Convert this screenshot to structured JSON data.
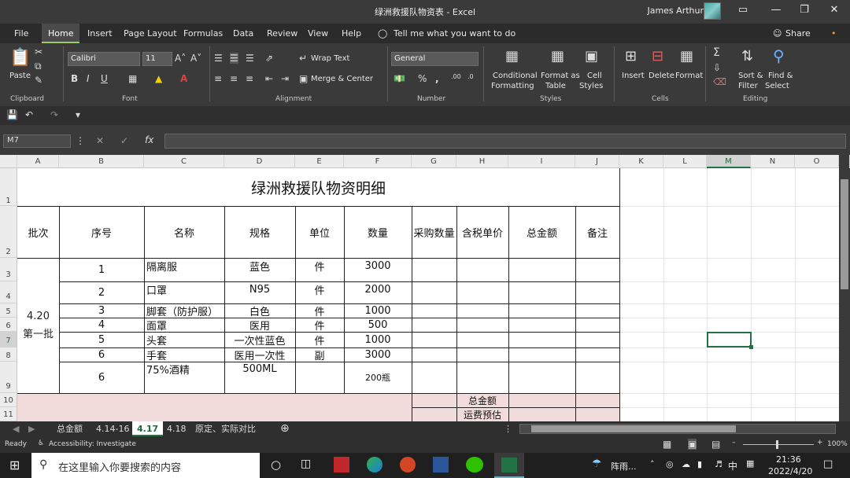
{
  "window": {
    "title": "绿洲救援队物资表  -  Excel",
    "user": "James Arthur",
    "controls": [
      "▭",
      "—",
      "❐",
      "✕"
    ]
  },
  "menu": {
    "items": [
      "File",
      "Home",
      "Insert",
      "Page Layout",
      "Formulas",
      "Data",
      "Review",
      "View",
      "Help"
    ],
    "tell_me": "Tell me what you want to do",
    "share": "Share"
  },
  "ribbon": {
    "clipboard": {
      "label": "Clipboard",
      "paste": "Paste"
    },
    "font": {
      "label": "Font",
      "name": "Calibri",
      "size": "11",
      "bold": "B",
      "italic": "I",
      "underline": "U"
    },
    "alignment": {
      "label": "Alignment",
      "wrap": "Wrap Text",
      "merge": "Merge & Center"
    },
    "number": {
      "label": "Number",
      "format": "General"
    },
    "styles": {
      "label": "Styles",
      "conditional": [
        "Conditional",
        "Formatting"
      ],
      "format_table": [
        "Format as",
        "Table"
      ],
      "cell_styles": [
        "Cell",
        "Styles"
      ]
    },
    "cells": {
      "label": "Cells",
      "insert": "Insert",
      "delete": "Delete",
      "format": "Format"
    },
    "editing": {
      "label": "Editing",
      "sort": [
        "Sort &",
        "Filter"
      ],
      "find": [
        "Find &",
        "Select"
      ]
    }
  },
  "formula_bar": {
    "name_box": "M7",
    "fx": "fx",
    "value": ""
  },
  "columns": [
    "A",
    "B",
    "C",
    "D",
    "E",
    "F",
    "G",
    "H",
    "I",
    "J",
    "K",
    "L",
    "M",
    "N",
    "O"
  ],
  "rows": [
    "1",
    "2",
    "3",
    "4",
    "5",
    "6",
    "7",
    "8",
    "9",
    "10",
    "11"
  ],
  "sheet": {
    "title": "绿洲救援队物资明细",
    "headers": [
      "批次",
      "序号",
      "名称",
      "规格",
      "单位",
      "数量",
      "采购数量",
      "含税单价",
      "总金额",
      "备注"
    ],
    "batch": [
      "4.20",
      "第一批"
    ],
    "items": [
      {
        "seq": "1",
        "name": "隔离服",
        "spec": "蓝色",
        "unit": "件",
        "qty": "3000"
      },
      {
        "seq": "2",
        "name": "口罩",
        "spec": "N95",
        "unit": "件",
        "qty": "2000"
      },
      {
        "seq": "3",
        "name": "脚套（防护服）",
        "spec": "白色",
        "unit": "件",
        "qty": "1000"
      },
      {
        "seq": "4",
        "name": "面罩",
        "spec": "医用",
        "unit": "件",
        "qty": "500"
      },
      {
        "seq": "5",
        "name": "头套",
        "spec": "一次性蓝色",
        "unit": "件",
        "qty": "1000"
      },
      {
        "seq": "6",
        "name": "手套",
        "spec": "医用一次性",
        "unit": "副",
        "qty": "3000"
      },
      {
        "seq": "6",
        "name": "75%酒精",
        "spec": "500ML",
        "unit": "",
        "qty": "200瓶"
      }
    ],
    "totals": [
      "总金额",
      "运费预估"
    ]
  },
  "tabs": [
    "总金额",
    "4.14-16",
    "4.17",
    "4.18",
    "原定、实际对比"
  ],
  "active_tab": "4.17",
  "status": {
    "ready": "Ready",
    "accessibility": "Accessibility: Investigate",
    "zoom": "100%"
  },
  "taskbar": {
    "search": "在这里输入你要搜索的内容",
    "weather": "阵雨...",
    "lang": "中",
    "time": "21:36",
    "date": "2022/4/20"
  },
  "colors": {
    "accent": "#217346",
    "pink_fill": "#f2dcdb",
    "chrome": "#3a3a3a"
  }
}
